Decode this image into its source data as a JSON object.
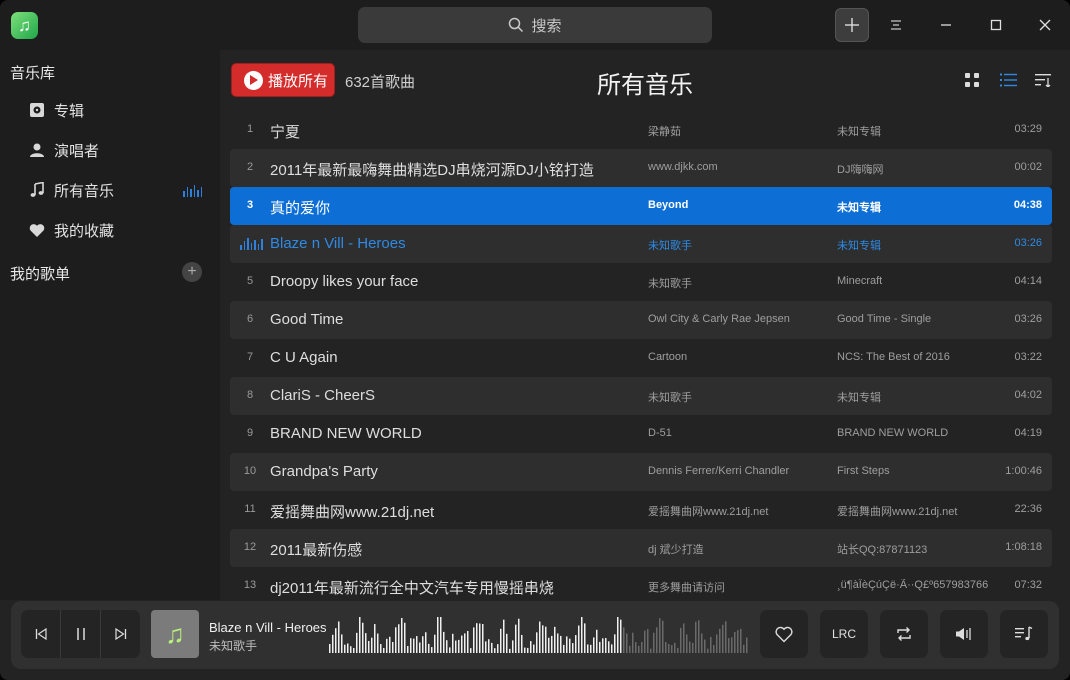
{
  "search": {
    "label": "搜索"
  },
  "sidebar": {
    "library_title": "音乐库",
    "items": [
      {
        "label": "专辑",
        "icon": "album-icon"
      },
      {
        "label": "演唱者",
        "icon": "person-icon"
      },
      {
        "label": "所有音乐",
        "icon": "music-note-icon"
      },
      {
        "label": "我的收藏",
        "icon": "heart-icon"
      }
    ],
    "playlists_title": "我的歌单"
  },
  "main": {
    "play_all_label": "播放所有",
    "song_count": "632首歌曲",
    "heading": "所有音乐"
  },
  "songs": [
    {
      "num": "1",
      "title": "宁夏",
      "artist": "梁静茹",
      "album": "未知专辑",
      "duration": "03:29"
    },
    {
      "num": "2",
      "title": "2011年最新最嗨舞曲精选DJ串烧河源DJ小铭打造",
      "artist": "www.djkk.com",
      "album": "DJ嗨嗨网",
      "duration": "00:02"
    },
    {
      "num": "3",
      "title": "真的爱你",
      "artist": "Beyond",
      "album": "未知专辑",
      "duration": "04:38"
    },
    {
      "num": "4",
      "title": "Blaze n Vill - Heroes",
      "artist": "未知歌手",
      "album": "未知专辑",
      "duration": "03:26"
    },
    {
      "num": "5",
      "title": "Droopy likes your face",
      "artist": "未知歌手",
      "album": "Minecraft",
      "duration": "04:14"
    },
    {
      "num": "6",
      "title": "Good Time",
      "artist": "Owl City & Carly Rae Jepsen",
      "album": "Good Time - Single",
      "duration": "03:26"
    },
    {
      "num": "7",
      "title": "C U Again",
      "artist": "Cartoon",
      "album": "NCS: The Best of 2016",
      "duration": "03:22"
    },
    {
      "num": "8",
      "title": "ClariS - CheerS",
      "artist": "未知歌手",
      "album": "未知专辑",
      "duration": "04:02"
    },
    {
      "num": "9",
      "title": "BRAND NEW WORLD",
      "artist": "D-51",
      "album": "BRAND NEW WORLD",
      "duration": "04:19"
    },
    {
      "num": "10",
      "title": "Grandpa's Party",
      "artist": "Dennis Ferrer/Kerri Chandler",
      "album": "First Steps",
      "duration": "1:00:46"
    },
    {
      "num": "11",
      "title": "爱摇舞曲网www.21dj.net",
      "artist": "爱摇舞曲网www.21dj.net",
      "album": "爱摇舞曲网www.21dj.net",
      "duration": "22:36"
    },
    {
      "num": "12",
      "title": "2011最新伤感",
      "artist": "dj 斌少打造",
      "album": "站长QQ:87871123",
      "duration": "1:08:18"
    },
    {
      "num": "13",
      "title": "dj2011年最新流行全中文汽车专用慢摇串烧",
      "artist": "更多舞曲请访问",
      "album": "¸ü¶àÎèÇúÇë·Ã··Q£º657983766",
      "duration": "07:32"
    }
  ],
  "player": {
    "title": "Blaze n Vill - Heroes",
    "artist": "未知歌手",
    "lrc_label": "LRC"
  },
  "colors": {
    "accent": "#0d6fd6",
    "play_all": "#d42b2b",
    "playing_text": "#2d8ae6"
  }
}
